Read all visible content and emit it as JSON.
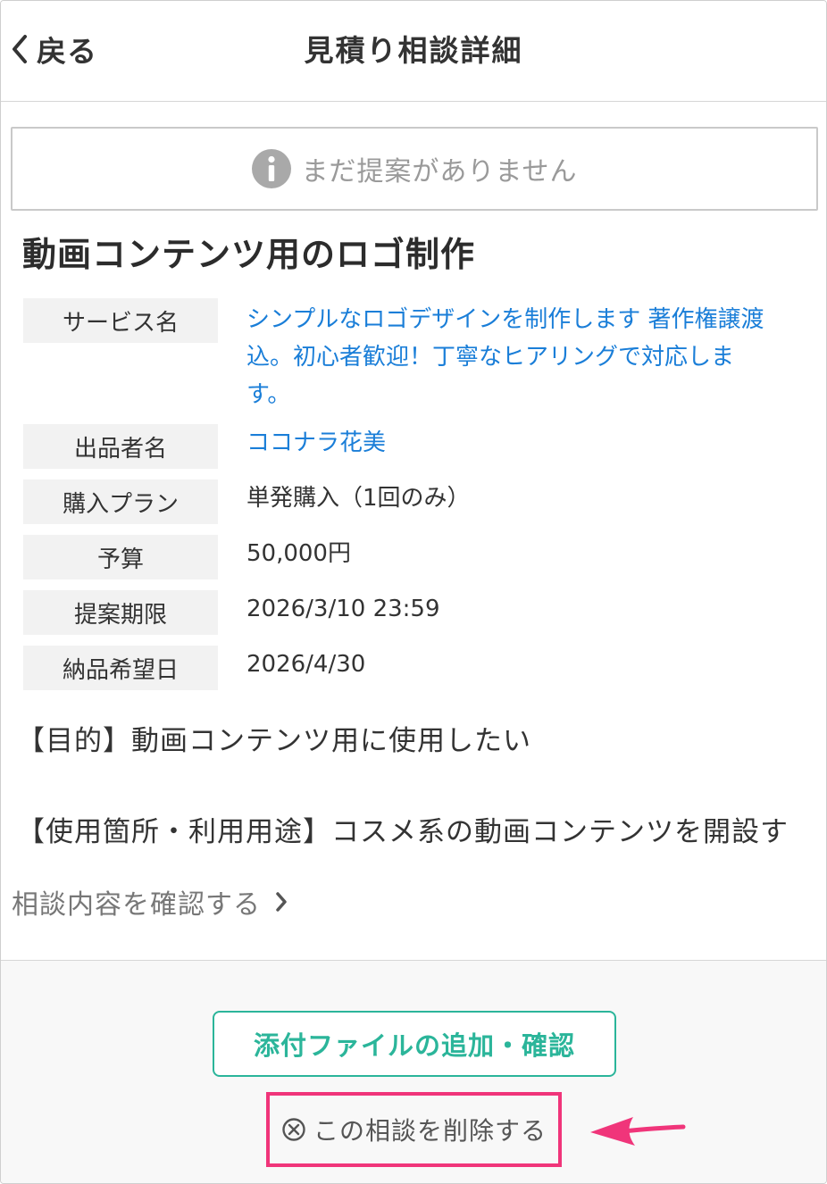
{
  "header": {
    "back_label": "戻る",
    "title": "見積り相談詳細"
  },
  "notice": {
    "text": "まだ提案がありません",
    "icon": "info-icon"
  },
  "request": {
    "title": "動画コンテンツ用のロゴ制作",
    "fields": [
      {
        "label": "サービス名",
        "value": "シンプルなロゴデザインを制作します 著作権譲渡込。初心者歓迎！丁寧なヒアリングで対応します。",
        "lines": [
          "シンプルなロゴデザインを制作します 著作権譲渡",
          "込。初心者歓迎！丁寧なヒアリングで対応しま",
          "す。"
        ],
        "link": true
      },
      {
        "label": "出品者名",
        "value": "ココナラ花美",
        "link": true
      },
      {
        "label": "購入プラン",
        "value": "単発購入（1回のみ）",
        "link": false
      },
      {
        "label": "予算",
        "value": "50,000円",
        "link": false
      },
      {
        "label": "提案期限",
        "value": "2026/3/10 23:59",
        "link": false
      },
      {
        "label": "納品希望日",
        "value": "2026/4/30",
        "link": false
      }
    ],
    "body": {
      "line1": "【目的】動画コンテンツ用に使用したい",
      "line2": "【使用箇所・利用用途】コスメ系の動画コンテンツを開設す"
    },
    "confirm_link": "相談内容を確認する"
  },
  "actions": {
    "attach_label": "添付ファイルの追加・確認",
    "delete_label": "この相談を削除する"
  },
  "colors": {
    "link": "#1a7ed8",
    "accent_green": "#2bb59a",
    "highlight_pink": "#f0357a",
    "label_bg": "#f2f2f2"
  }
}
